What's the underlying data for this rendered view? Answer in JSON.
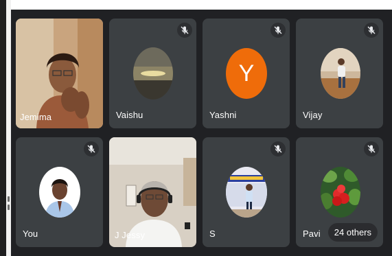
{
  "participants": [
    {
      "name": "Jemima"
    },
    {
      "name": "Vaishu"
    },
    {
      "name": "Yashni",
      "initial": "Y"
    },
    {
      "name": "Vijay"
    },
    {
      "name": "You"
    },
    {
      "name": "J Jessy"
    },
    {
      "name": "S"
    },
    {
      "name": "Pavi"
    }
  ],
  "others_badge": "24 others",
  "colors": {
    "background": "#202124",
    "tile": "#3c4043",
    "avatar_orange": "#ef6c0a",
    "active_speaker_border": "#8ab4f8"
  },
  "icons": {
    "mute": "mic-off-icon"
  }
}
